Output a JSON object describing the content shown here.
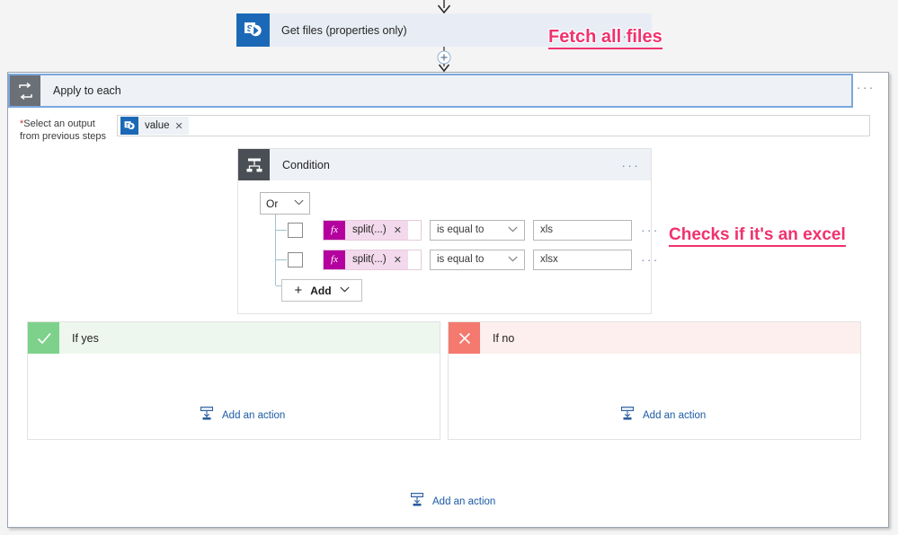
{
  "flow": {
    "top_action": {
      "title": "Get files (properties only)",
      "icon": "sharepoint-icon",
      "menu": "···"
    },
    "loop": {
      "title": "Apply to each",
      "icon": "loop-icon",
      "menu": "···",
      "output_label_required": "*",
      "output_label_line1": "Select an output",
      "output_label_line2": "from previous steps",
      "token": {
        "label": "value",
        "remove": "✕",
        "icon": "sharepoint-icon"
      }
    },
    "condition": {
      "title": "Condition",
      "icon": "condition-icon",
      "menu": "···",
      "logic_operator": "Or",
      "logic_chevron": "∨",
      "rows": [
        {
          "checkbox_checked": false,
          "fx_badge": "fx",
          "expression": "split(...)",
          "expression_remove": "✕",
          "operator": "is equal to",
          "operator_chevron": "∨",
          "value": "xls",
          "menu": "···"
        },
        {
          "checkbox_checked": false,
          "fx_badge": "fx",
          "expression": "split(...)",
          "expression_remove": "✕",
          "operator": "is equal to",
          "operator_chevron": "∨",
          "value": "xlsx",
          "menu": "···"
        }
      ],
      "add_button": {
        "plus": "+",
        "label": "Add",
        "chevron": "∨"
      }
    },
    "branches": {
      "yes": {
        "title": "If yes",
        "badge_icon": "check-icon",
        "add_action": "Add an action"
      },
      "no": {
        "title": "If no",
        "badge_icon": "cross-icon",
        "add_action": "Add an action"
      }
    },
    "loop_add_action": "Add an action"
  },
  "annotations": [
    {
      "text": "Fetch all files"
    },
    {
      "text": "Checks if it's an excel"
    }
  ],
  "colors": {
    "sharepoint_blue": "#1b69b6",
    "accent_pink": "#f0326e",
    "yes_green": "#7ed18a",
    "no_red": "#f4796f",
    "fx_magenta": "#b4009e",
    "link_blue": "#1b5aa4"
  }
}
